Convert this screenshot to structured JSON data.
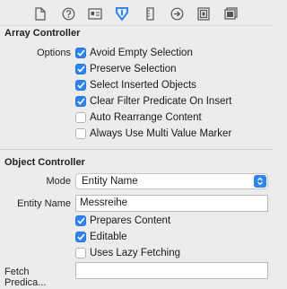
{
  "toolbar": {
    "icons": [
      {
        "name": "file-icon",
        "selected": false
      },
      {
        "name": "help-icon",
        "selected": false
      },
      {
        "name": "identity-icon",
        "selected": false
      },
      {
        "name": "attributes-icon",
        "selected": true
      },
      {
        "name": "size-icon",
        "selected": false
      },
      {
        "name": "connections-icon",
        "selected": false
      },
      {
        "name": "bindings-icon",
        "selected": false
      },
      {
        "name": "view-effects-icon",
        "selected": false
      }
    ],
    "accent": "#2d84f2"
  },
  "array_controller": {
    "title": "Array Controller",
    "options_label": "Options",
    "options": [
      {
        "label": "Avoid Empty Selection",
        "checked": true
      },
      {
        "label": "Preserve Selection",
        "checked": true
      },
      {
        "label": "Select Inserted Objects",
        "checked": true
      },
      {
        "label": "Clear Filter Predicate On Insert",
        "checked": true
      },
      {
        "label": "Auto Rearrange Content",
        "checked": false
      },
      {
        "label": "Always Use Multi Value Marker",
        "checked": false
      }
    ]
  },
  "object_controller": {
    "title": "Object Controller",
    "mode_label": "Mode",
    "mode_value": "Entity Name",
    "entity_name_label": "Entity Name",
    "entity_name_value": "Messreihe",
    "options": [
      {
        "label": "Prepares Content",
        "checked": true
      },
      {
        "label": "Editable",
        "checked": true
      },
      {
        "label": "Uses Lazy Fetching",
        "checked": false
      }
    ],
    "fetch_predicate_label": "Fetch Predica...",
    "fetch_predicate_value": ""
  }
}
